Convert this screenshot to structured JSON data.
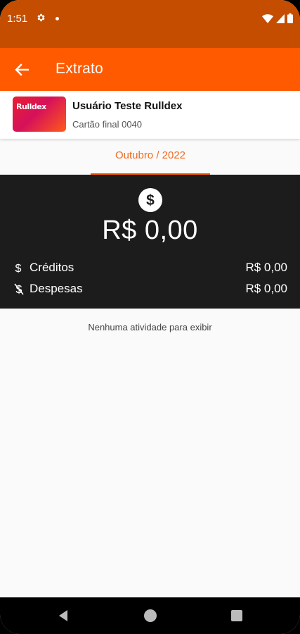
{
  "status_bar": {
    "time": "1:51",
    "icons": [
      "gear-icon",
      "dot-icon",
      "wifi-icon",
      "signal-icon",
      "battery-icon"
    ]
  },
  "app_bar": {
    "title": "Extrato",
    "back_icon": "arrow-left-icon"
  },
  "card": {
    "logo_text": "Rulldex",
    "user_name": "Usuário Teste Rulldex",
    "subtitle": "Cartão final 0040"
  },
  "month_tab": {
    "label": "Outubro / 2022"
  },
  "summary": {
    "total": "R$  0,00",
    "credits_label": "Créditos",
    "credits_value": "R$  0,00",
    "expenses_label": "Despesas",
    "expenses_value": "R$  0,00"
  },
  "empty_message": "Nenhuma atividade para exibir",
  "colors": {
    "status_bar": "#c44d00",
    "app_bar": "#ff5a00",
    "accent": "#f06a20",
    "summary_bg": "#1c1c1c"
  }
}
